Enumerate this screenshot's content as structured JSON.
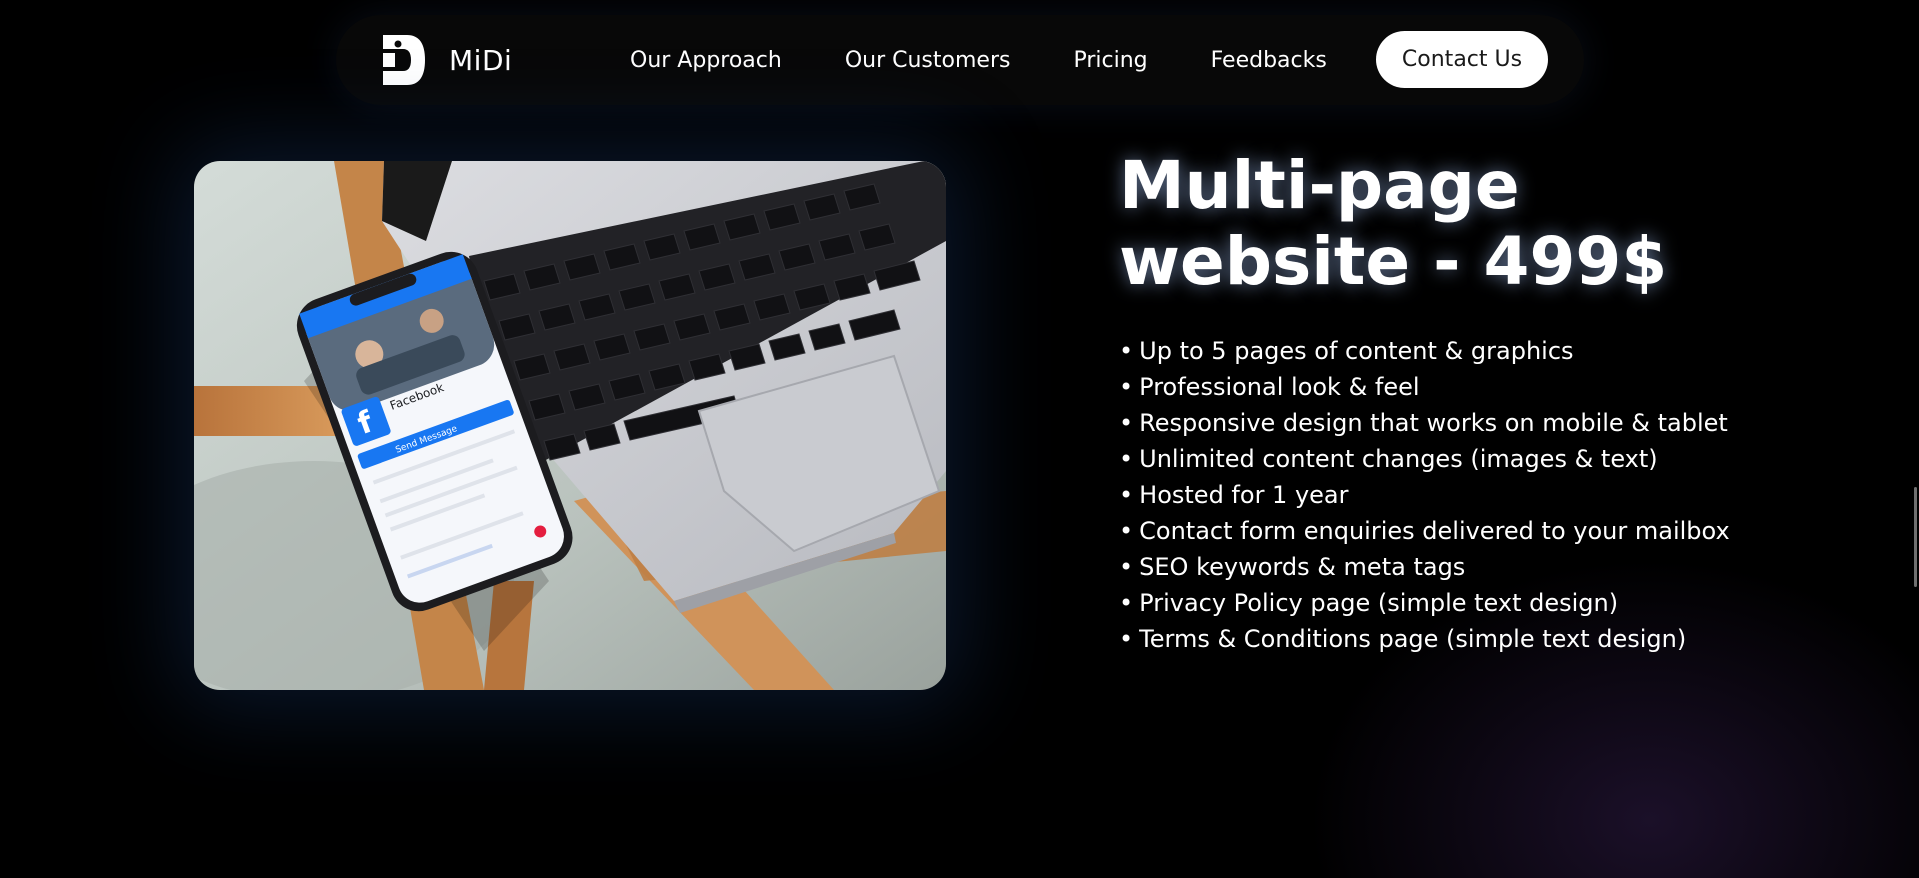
{
  "brand": {
    "name": "MiDi"
  },
  "nav": {
    "links": [
      "Our Approach",
      "Our Customers",
      "Pricing",
      "Feedbacks"
    ],
    "contact_label": "Contact Us"
  },
  "pricing": {
    "title_line1": "Multi-page",
    "title_line2": "website - 499$",
    "features": [
      "Up to 5 pages of content & graphics",
      "Professional look & feel",
      "Responsive design that works on mobile & tablet",
      "Unlimited content changes (images & text)",
      "Hosted for 1 year",
      "Contact form enquiries delivered to your mailbox",
      "SEO keywords & meta tags",
      "Privacy Policy page (simple text design)",
      "Terms & Conditions page (simple text design)"
    ]
  },
  "photo": {
    "phone_app": "Facebook",
    "phone_button": "Send Message"
  },
  "colors": {
    "background": "#000000",
    "nav_background": "#080808",
    "button_background": "#ffffff",
    "button_text": "#1a1a1a",
    "glow": "#1e4682",
    "facebook_blue": "#1877f2"
  },
  "icons": {
    "logo": "midi-logo-icon"
  }
}
